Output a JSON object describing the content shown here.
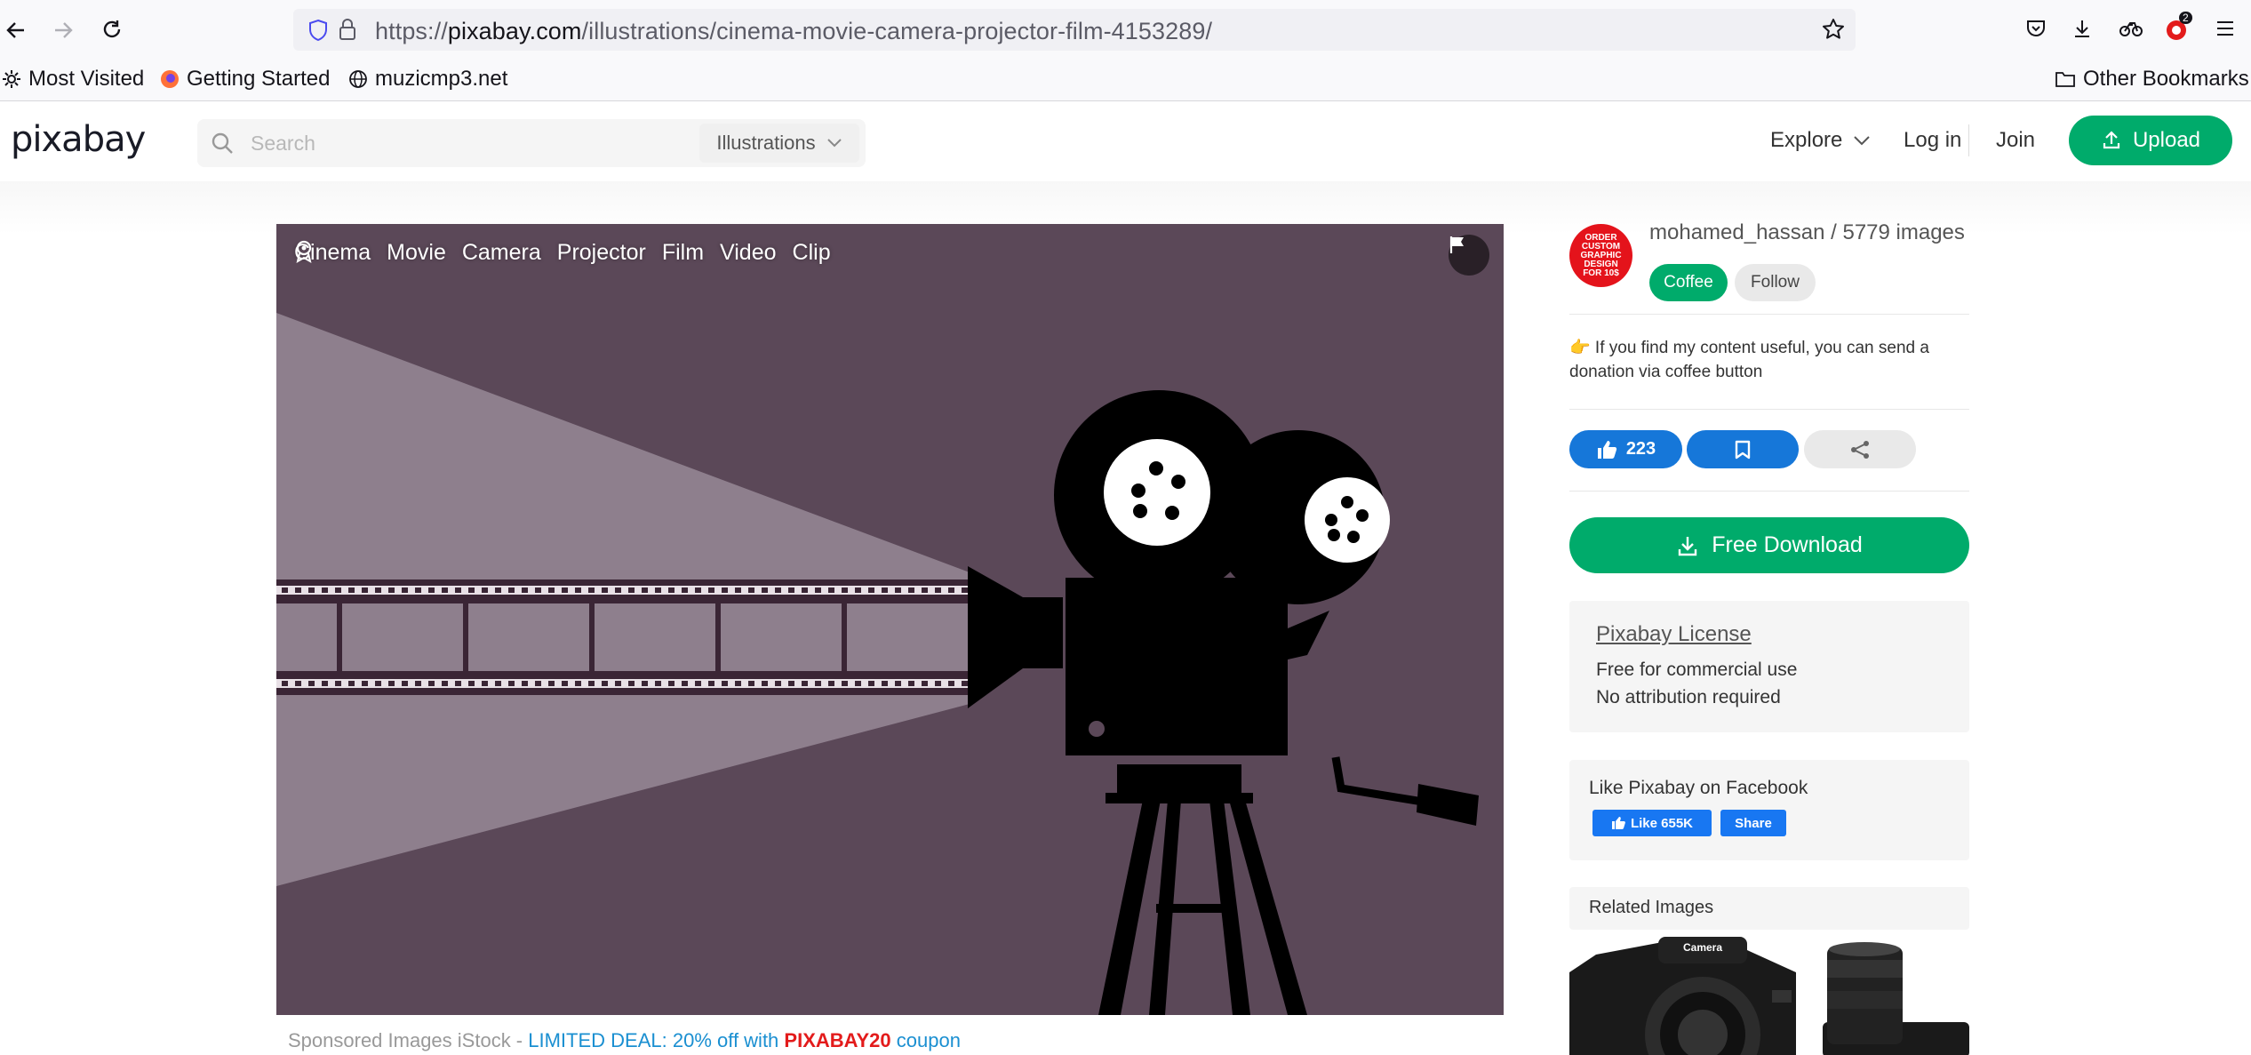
{
  "browser": {
    "url_prefix": "https://",
    "url_domain": "pixabay.com",
    "url_path": "/illustrations/cinema-movie-camera-projector-film-4153289/",
    "bookmarks": [
      "Most Visited",
      "Getting Started",
      "muzicmp3.net"
    ],
    "other_bookmarks": "Other Bookmarks",
    "extension_badge": "2"
  },
  "header": {
    "logo": "pixabay",
    "search_placeholder": "Search",
    "search_category": "Illustrations",
    "explore": "Explore",
    "login": "Log in",
    "join": "Join",
    "upload": "Upload"
  },
  "image": {
    "tags": [
      "Cinema",
      "Movie",
      "Camera",
      "Projector",
      "Film",
      "Video",
      "Clip"
    ]
  },
  "sponsored": {
    "prefix": "Sponsored Images iStock - ",
    "deal": "LIMITED DEAL: 20% off with ",
    "code": "PIXABAY20",
    "suffix": " coupon"
  },
  "author": {
    "name_line": "mohamed_hassan / 5779 images",
    "avatar_text": "ORDER CUSTOM GRAPHIC DESIGN FOR 10$",
    "coffee": "Coffee",
    "follow": "Follow",
    "note": "👉 If you find my content useful, you can send a donation via coffee button"
  },
  "actions": {
    "likes": "223",
    "download": "Free Download"
  },
  "license": {
    "title": "Pixabay License",
    "line1": "Free for commercial use",
    "line2": "No attribution required"
  },
  "facebook": {
    "title": "Like Pixabay on Facebook",
    "like": "Like 655K",
    "share": "Share"
  },
  "related": {
    "title": "Related Images",
    "thumb_label": "Camera"
  },
  "colors": {
    "brand_green": "#00ab6b",
    "like_blue": "#1677d9",
    "image_bg": "#5b4858"
  }
}
